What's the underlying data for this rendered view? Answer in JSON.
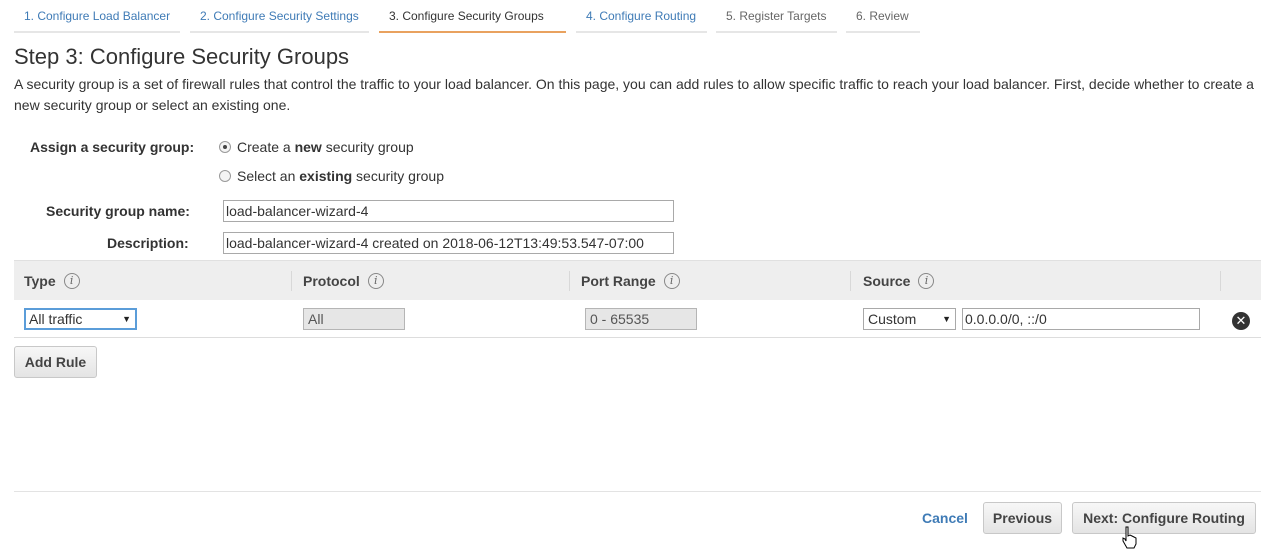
{
  "tabs": [
    {
      "label": "1. Configure Load Balancer",
      "state": "link"
    },
    {
      "label": "2. Configure Security Settings",
      "state": "link"
    },
    {
      "label": "3. Configure Security Groups",
      "state": "active"
    },
    {
      "label": "4. Configure Routing",
      "state": "link"
    },
    {
      "label": "5. Register Targets",
      "state": "disabled"
    },
    {
      "label": "6. Review",
      "state": "disabled"
    }
  ],
  "page": {
    "title": "Step 3: Configure Security Groups",
    "intro": "A security group is a set of firewall rules that control the traffic to your load balancer. On this page, you can add rules to allow specific traffic to reach your load balancer. First, decide whether to create a new security group or select an existing one."
  },
  "form": {
    "assign_label": "Assign a security group:",
    "option_new": {
      "pre": "Create a ",
      "bold": "new",
      "post": " security group",
      "selected": true
    },
    "option_existing": {
      "pre": "Select an ",
      "bold": "existing",
      "post": " security group",
      "selected": false
    },
    "name_label": "Security group name:",
    "name_value": "load-balancer-wizard-4",
    "desc_label": "Description:",
    "desc_value": "load-balancer-wizard-4 created on 2018-06-12T13:49:53.547-07:00"
  },
  "table": {
    "headers": {
      "type": "Type",
      "protocol": "Protocol",
      "port_range": "Port Range",
      "source": "Source"
    },
    "info_glyph": "i",
    "row": {
      "type": "All traffic",
      "protocol": "All",
      "port_range": "0 - 65535",
      "source_type": "Custom",
      "source_value": "0.0.0.0/0, ::/0",
      "remove_glyph": "✕"
    }
  },
  "buttons": {
    "add_rule": "Add Rule",
    "cancel": "Cancel",
    "previous": "Previous",
    "next": "Next: Configure Routing"
  },
  "icons": {
    "info": "info-icon",
    "remove": "remove-circle-icon",
    "dropdown": "chevron-down-icon",
    "cursor": "hand-pointer-icon"
  },
  "colors": {
    "link": "#3f7bb6",
    "active_tab_underline": "#e9a25f",
    "header_bg": "#eeeeee"
  },
  "glyphs": {
    "dropdown": "▼"
  }
}
